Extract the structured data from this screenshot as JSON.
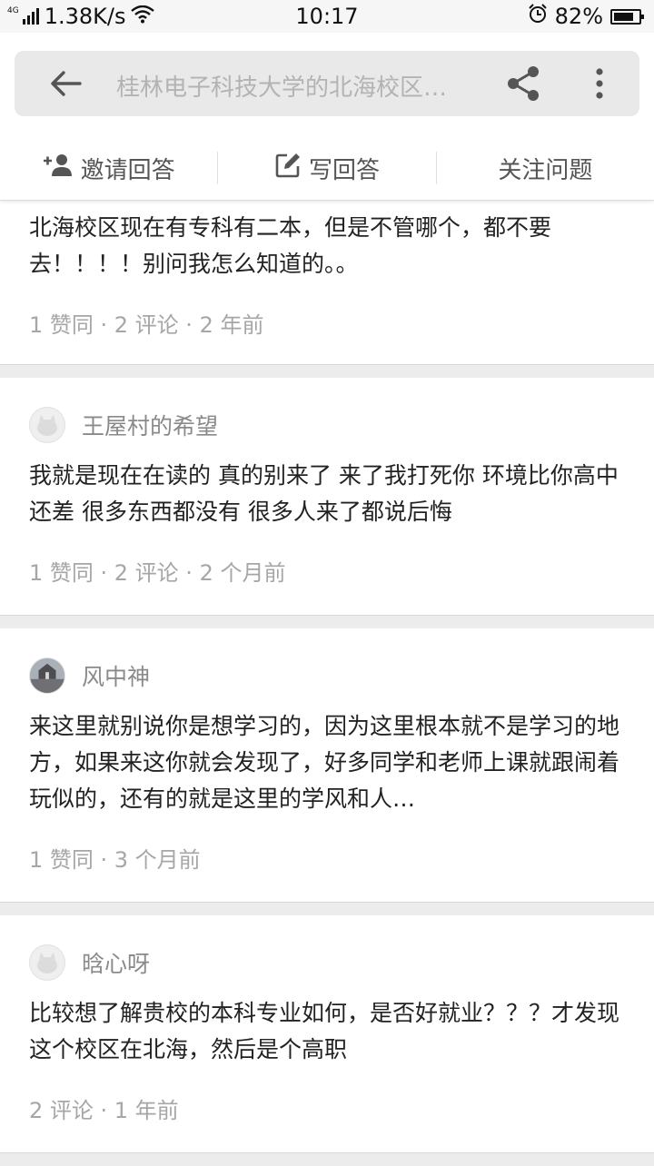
{
  "status_bar": {
    "network_speed": "1.38K/s",
    "network_type": "4G",
    "time": "10:17",
    "battery": "82%",
    "battery_level": 0.82
  },
  "header": {
    "title": "桂林电子科技大学的北海校区…",
    "back_icon": "arrow-left-icon",
    "share_icon": "share-icon",
    "more_icon": "more-vertical-icon"
  },
  "actions": {
    "invite": "邀请回答",
    "write": "写回答",
    "follow": "关注问题"
  },
  "answers": [
    {
      "text": "北海校区现在有专科有二本，但是不管哪个，都不要去！！！！别问我怎么知道的。。",
      "meta": "1 赞同 · 2 评论 · 2 年前"
    },
    {
      "author": "王屋村的希望",
      "text": "我就是现在在读的 真的别来了 来了我打死你 环境比你高中还差 很多东西都没有 很多人来了都说后悔",
      "meta": "1 赞同 · 2 评论 · 2 个月前"
    },
    {
      "author": "风中神",
      "text": "来这里就别说你是想学习的，因为这里根本就不是学习的地方，如果来这你就会发现了，好多同学和老师上课就跟闹着玩似的，还有的就是这里的学风和人…",
      "meta": "1 赞同 · 3 个月前"
    },
    {
      "author": "晗心呀",
      "text": "比较想了解贵校的本科专业如何，是否好就业？？？才发现这个校区在北海，然后是个高职",
      "meta": "2 评论 · 1 年前"
    }
  ]
}
